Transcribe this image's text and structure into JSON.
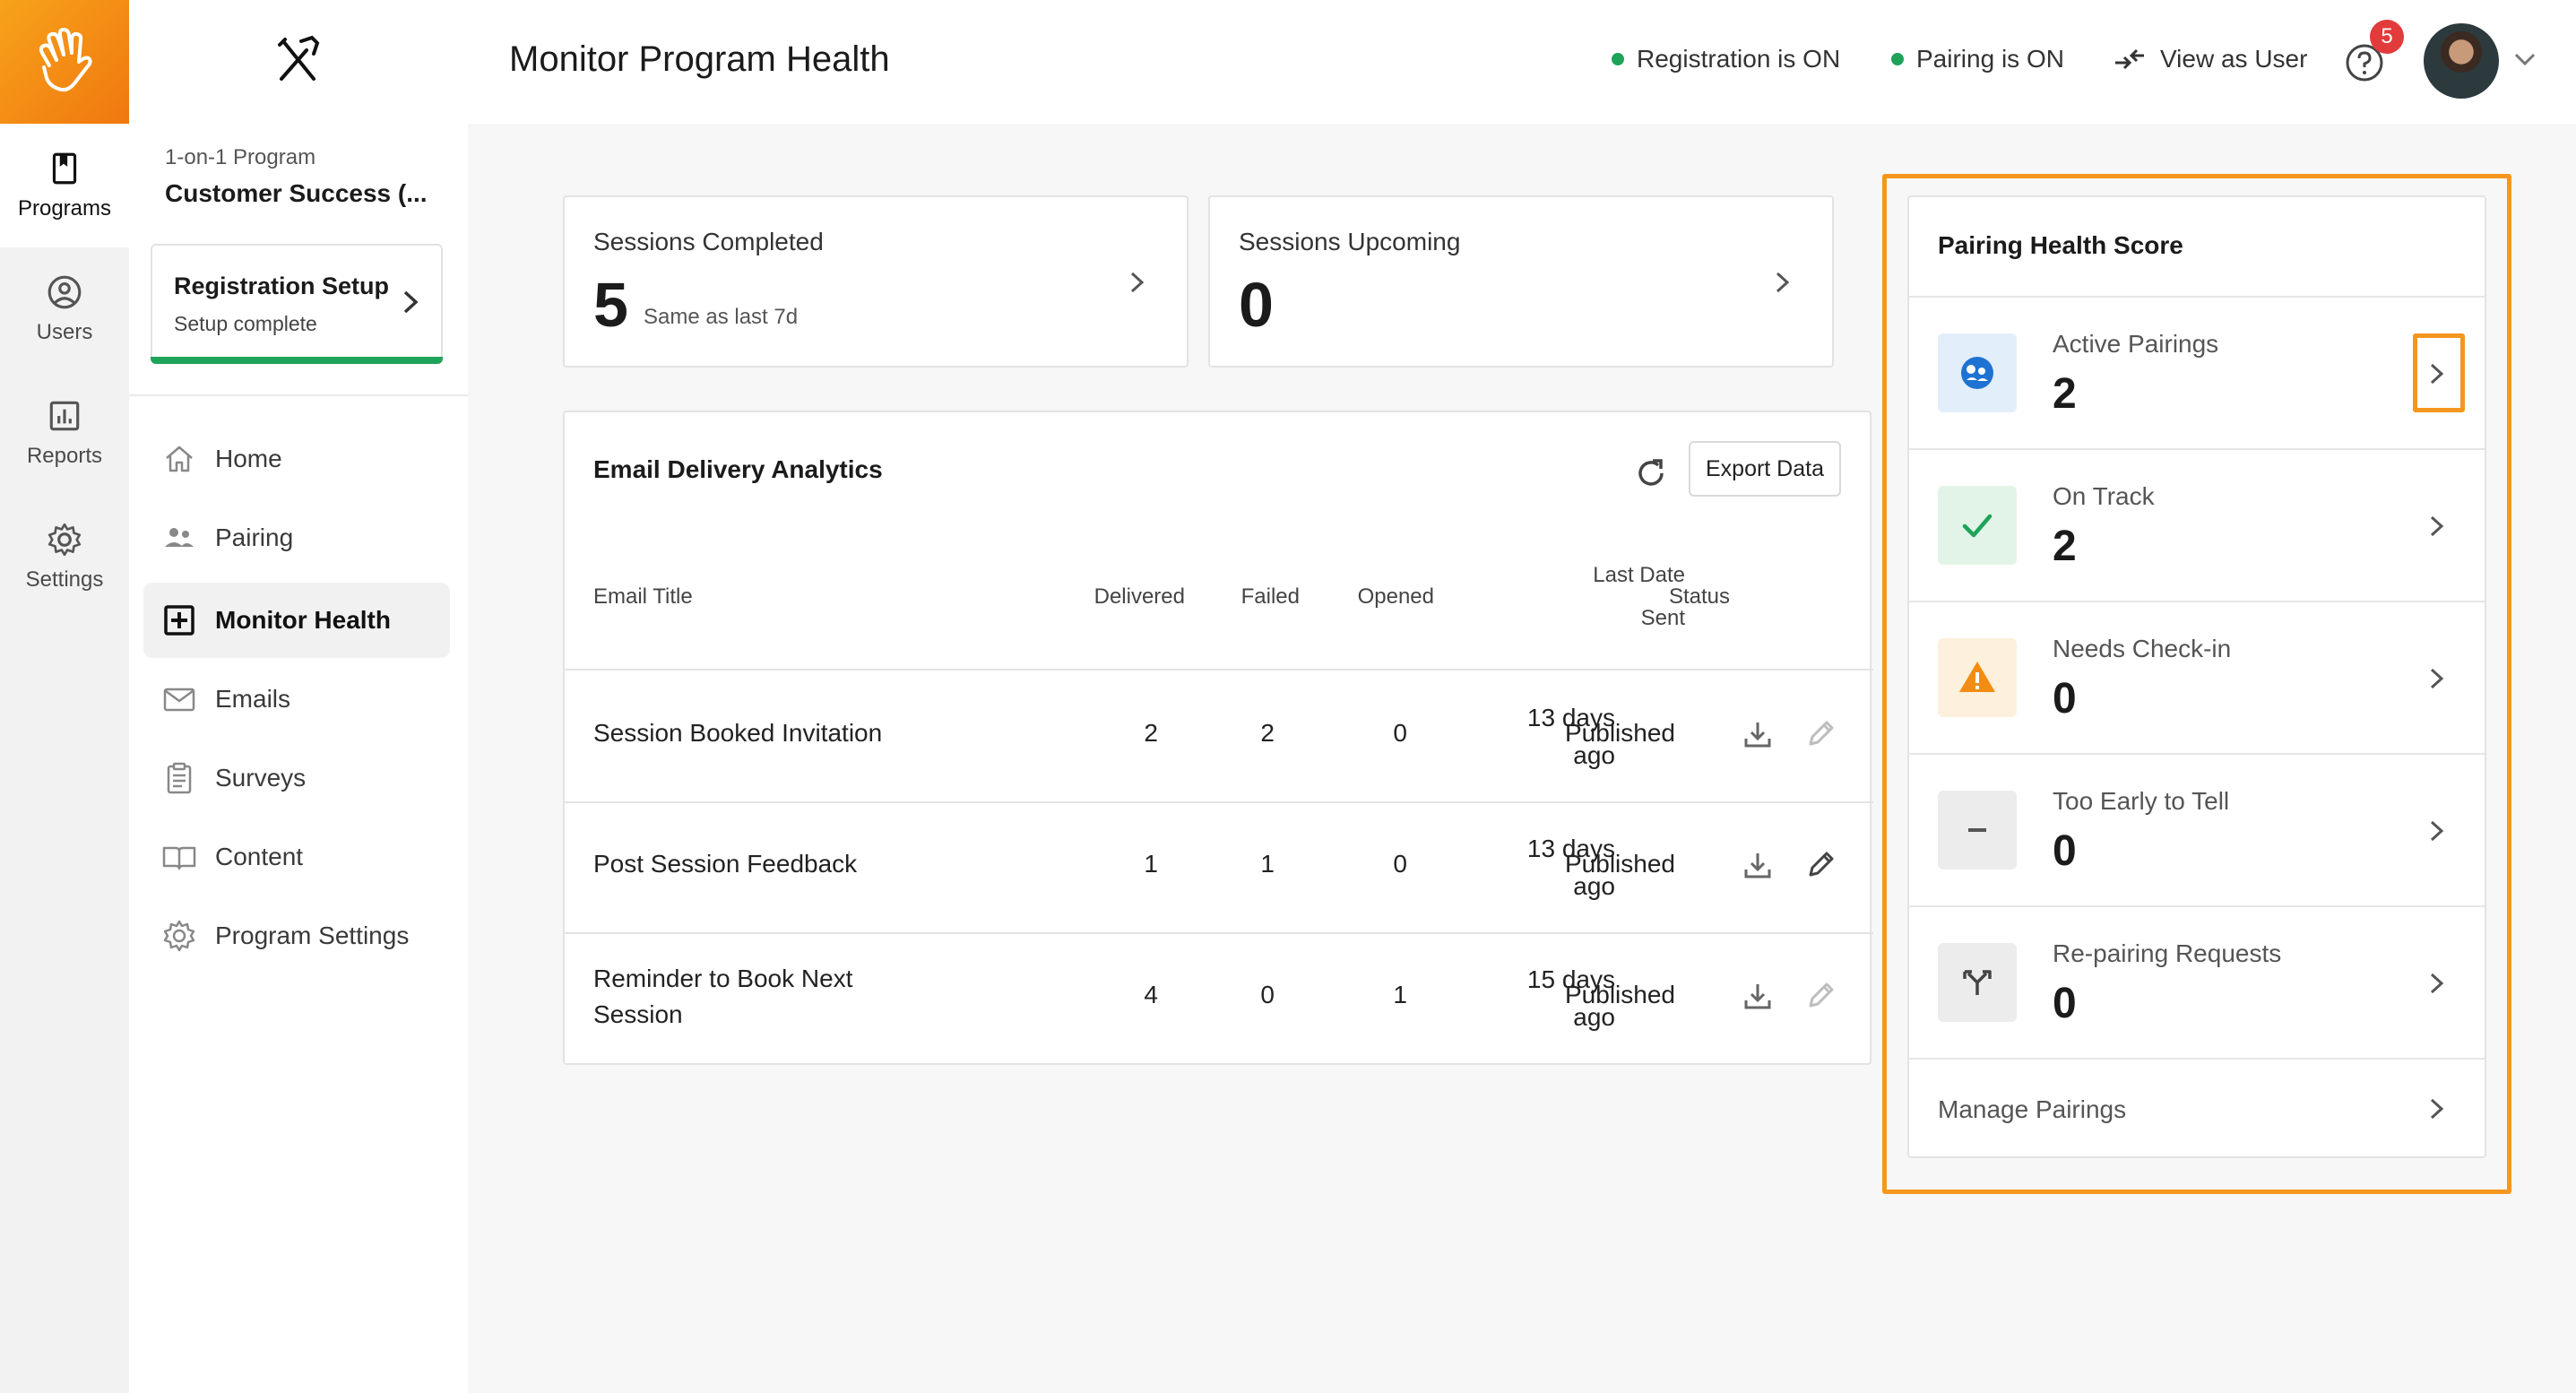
{
  "rail": {
    "items": [
      {
        "label": "Programs"
      },
      {
        "label": "Users"
      },
      {
        "label": "Reports"
      },
      {
        "label": "Settings"
      }
    ]
  },
  "sidebar": {
    "program_type": "1-on-1 Program",
    "program_name": "Customer Success (...",
    "registration": {
      "title": "Registration Setup",
      "subtitle": "Setup complete"
    },
    "nav": [
      {
        "label": "Home"
      },
      {
        "label": "Pairing"
      },
      {
        "label": "Monitor Health"
      },
      {
        "label": "Emails"
      },
      {
        "label": "Surveys"
      },
      {
        "label": "Content"
      },
      {
        "label": "Program Settings"
      }
    ]
  },
  "header": {
    "title": "Monitor Program Health",
    "registration_status": "Registration is ON",
    "pairing_status": "Pairing is ON",
    "view_as_user": "View as User",
    "notification_count": "5"
  },
  "stats": {
    "completed": {
      "label": "Sessions Completed",
      "value": "5",
      "sub": "Same as last 7d"
    },
    "upcoming": {
      "label": "Sessions Upcoming",
      "value": "0"
    }
  },
  "email_analytics": {
    "title": "Email Delivery Analytics",
    "export_label": "Export Data",
    "columns": {
      "title": "Email Title",
      "delivered": "Delivered",
      "failed": "Failed",
      "opened": "Opened",
      "last_date_1": "Last Date",
      "last_date_2": "Sent",
      "status": "Status"
    },
    "rows": [
      {
        "title_1": "Session Booked Invitation",
        "title_2": "",
        "delivered": "2",
        "failed": "2",
        "opened": "0",
        "date_1": "13 days",
        "date_2": "ago",
        "status": "Published"
      },
      {
        "title_1": "Post Session Feedback",
        "title_2": "",
        "delivered": "1",
        "failed": "1",
        "opened": "0",
        "date_1": "13 days",
        "date_2": "ago",
        "status": "Published"
      },
      {
        "title_1": "Reminder to Book Next",
        "title_2": "Session",
        "delivered": "4",
        "failed": "0",
        "opened": "1",
        "date_1": "15 days",
        "date_2": "ago",
        "status": "Published"
      }
    ]
  },
  "pairing_health": {
    "title": "Pairing Health Score",
    "items": [
      {
        "label": "Active Pairings",
        "value": "2",
        "icon": "pairing-face-icon"
      },
      {
        "label": "On Track",
        "value": "2",
        "icon": "check-icon"
      },
      {
        "label": "Needs Check-in",
        "value": "0",
        "icon": "warning-icon"
      },
      {
        "label": "Too Early to Tell",
        "value": "0",
        "icon": "dash-icon"
      },
      {
        "label": "Re-pairing Requests",
        "value": "0",
        "icon": "split-arrows-icon"
      }
    ],
    "manage_label": "Manage Pairings"
  },
  "colors": {
    "brand_orange": "#f5961e",
    "status_green": "#1fa35a",
    "badge_red": "#e23b3b"
  }
}
